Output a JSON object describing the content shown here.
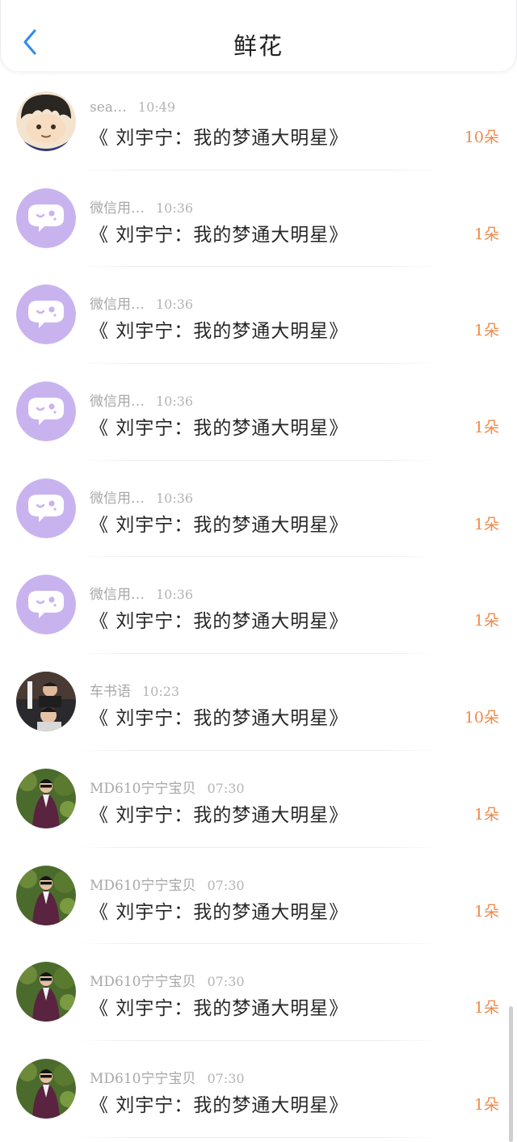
{
  "header": {
    "title": "鲜花",
    "back_icon": "chevron-left-icon",
    "accent": "#2f8ce8"
  },
  "count_color": "#f08a4b",
  "rows": [
    {
      "avatar": "anime-boy-avatar",
      "name": "sea…",
      "time": "10:49",
      "message": "《 刘宇宁：我的梦通大明星》",
      "count": "10朵"
    },
    {
      "avatar": "wechat-default-avatar",
      "name": "微信用…",
      "time": "10:36",
      "message": "《 刘宇宁：我的梦通大明星》",
      "count": "1朵"
    },
    {
      "avatar": "wechat-default-avatar",
      "name": "微信用…",
      "time": "10:36",
      "message": "《 刘宇宁：我的梦通大明星》",
      "count": "1朵"
    },
    {
      "avatar": "wechat-default-avatar",
      "name": "微信用…",
      "time": "10:36",
      "message": "《 刘宇宁：我的梦通大明星》",
      "count": "1朵"
    },
    {
      "avatar": "wechat-default-avatar",
      "name": "微信用…",
      "time": "10:36",
      "message": "《 刘宇宁：我的梦通大明星》",
      "count": "1朵"
    },
    {
      "avatar": "wechat-default-avatar",
      "name": "微信用…",
      "time": "10:36",
      "message": "《 刘宇宁：我的梦通大明星》",
      "count": "1朵"
    },
    {
      "avatar": "singer-photo-avatar",
      "name": "车书语",
      "time": "10:23",
      "message": "《 刘宇宁：我的梦通大明星》",
      "count": "10朵"
    },
    {
      "avatar": "purple-suit-photo-avatar",
      "name": "MD610宁宁宝贝",
      "time": "07:30",
      "message": "《 刘宇宁：我的梦通大明星》",
      "count": "1朵"
    },
    {
      "avatar": "purple-suit-photo-avatar",
      "name": "MD610宁宁宝贝",
      "time": "07:30",
      "message": "《 刘宇宁：我的梦通大明星》",
      "count": "1朵"
    },
    {
      "avatar": "purple-suit-photo-avatar",
      "name": "MD610宁宁宝贝",
      "time": "07:30",
      "message": "《 刘宇宁：我的梦通大明星》",
      "count": "1朵"
    },
    {
      "avatar": "purple-suit-photo-avatar",
      "name": "MD610宁宁宝贝",
      "time": "07:30",
      "message": "《 刘宇宁：我的梦通大明星》",
      "count": "1朵"
    }
  ]
}
